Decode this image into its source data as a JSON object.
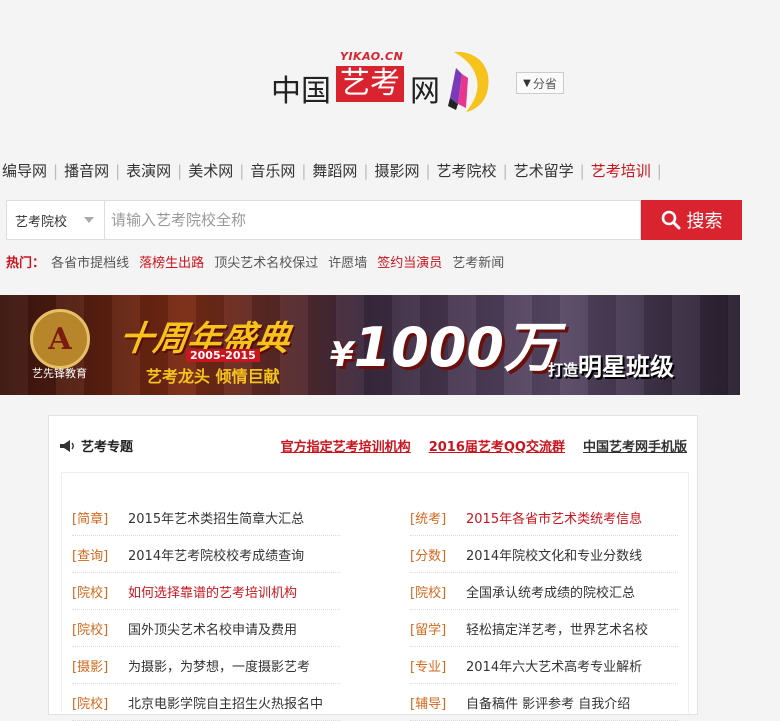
{
  "logo": {
    "left": "中国",
    "middle": "艺考",
    "right": "网",
    "domain": "YIKAO.CN"
  },
  "province_button": {
    "label": "分省",
    "icon": "caret-down-icon"
  },
  "nav": [
    {
      "label": "编导网",
      "hot": false
    },
    {
      "label": "播音网",
      "hot": false
    },
    {
      "label": "表演网",
      "hot": false
    },
    {
      "label": "美术网",
      "hot": false
    },
    {
      "label": "音乐网",
      "hot": false
    },
    {
      "label": "舞蹈网",
      "hot": false
    },
    {
      "label": "摄影网",
      "hot": false
    },
    {
      "label": "艺考院校",
      "hot": false
    },
    {
      "label": "艺术留学",
      "hot": false
    },
    {
      "label": "艺考培训",
      "hot": true
    }
  ],
  "search": {
    "category": "艺考院校",
    "placeholder": "请输入艺考院校全称",
    "button_label": "搜索"
  },
  "hot": {
    "label": "热门：",
    "links": [
      {
        "text": "各省市提档线",
        "highlight": false
      },
      {
        "text": "落榜生出路",
        "highlight": true
      },
      {
        "text": "顶尖艺术名校保过",
        "highlight": false
      },
      {
        "text": "许愿墙",
        "highlight": false
      },
      {
        "text": "签约当演员",
        "highlight": true
      },
      {
        "text": "艺考新闻",
        "highlight": false
      }
    ]
  },
  "banner": {
    "emblem": "A",
    "org": "艺先锋教育",
    "anniversary": "十周年盛典",
    "years": "2005-2015",
    "slogan": "艺考龙头 倾情巨献",
    "currency": "¥",
    "amount": "1000万",
    "tagline_small": "打造",
    "tagline": "明星班级"
  },
  "panel": {
    "title": "艺考专题",
    "title_icon": "megaphone-icon",
    "links": [
      {
        "text": "官方指定艺考培训机构",
        "red": true
      },
      {
        "text": "2016届艺考QQ交流群",
        "red": true
      },
      {
        "text": "中国艺考网手机版",
        "red": false
      }
    ],
    "left_items": [
      {
        "tag": "[简章]",
        "text": "2015年艺术类招生简章大汇总",
        "red": false
      },
      {
        "tag": "[查询]",
        "text": "2014年艺考院校校考成绩查询",
        "red": false
      },
      {
        "tag": "[院校]",
        "text": "如何选择靠谱的艺考培训机构",
        "red": true
      },
      {
        "tag": "[院校]",
        "text": "国外顶尖艺术名校申请及费用",
        "red": false
      },
      {
        "tag": "[摄影]",
        "text": "为摄影，为梦想，一度摄影艺考",
        "red": false
      },
      {
        "tag": "[院校]",
        "text": "北京电影学院自主招生火热报名中",
        "red": false
      }
    ],
    "right_items": [
      {
        "tag": "[统考]",
        "text": "2015年各省市艺术类统考信息",
        "red": true
      },
      {
        "tag": "[分数]",
        "text": "2014年院校文化和专业分数线",
        "red": false
      },
      {
        "tag": "[院校]",
        "text": "全国承认统考成绩的院校汇总",
        "red": false
      },
      {
        "tag": "[留学]",
        "text": "轻松搞定洋艺考，世界艺术名校",
        "red": false
      },
      {
        "tag": "[专业]",
        "text": "2014年六大艺术高考专业解析",
        "red": false
      },
      {
        "tag": "[辅导]",
        "text": "自备稿件 影评参考 自我介绍",
        "red": false
      }
    ]
  },
  "colors": {
    "brand_red": "#d9232f",
    "link_red": "#c9151e",
    "tag_orange": "#d2691e"
  }
}
